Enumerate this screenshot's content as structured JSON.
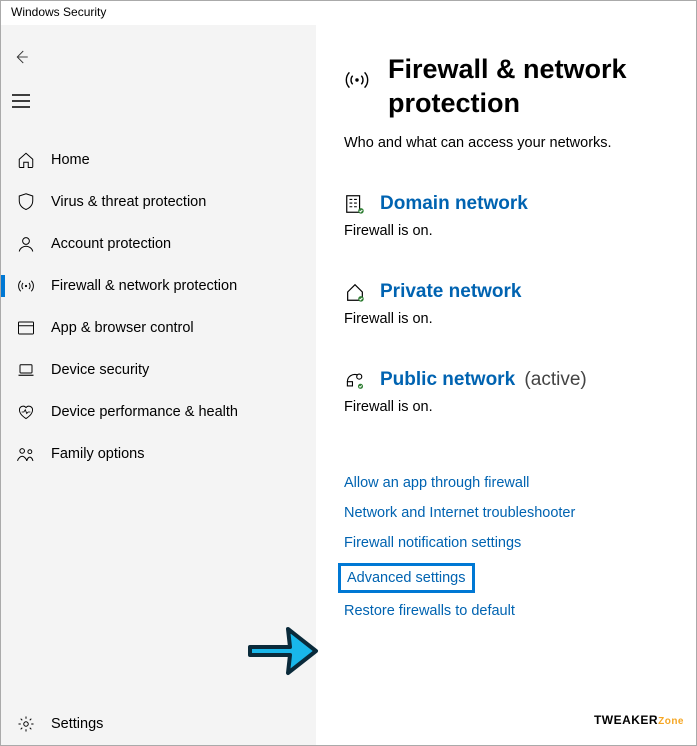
{
  "window_title": "Windows Security",
  "sidebar": {
    "items": [
      {
        "label": "Home"
      },
      {
        "label": "Virus & threat protection"
      },
      {
        "label": "Account protection"
      },
      {
        "label": "Firewall & network protection"
      },
      {
        "label": "App & browser control"
      },
      {
        "label": "Device security"
      },
      {
        "label": "Device performance & health"
      },
      {
        "label": "Family options"
      }
    ],
    "bottom": {
      "label": "Settings"
    }
  },
  "page": {
    "title": "Firewall & network protection",
    "description": "Who and what can access your networks."
  },
  "networks": [
    {
      "title": "Domain network",
      "status": "Firewall is on.",
      "suffix": ""
    },
    {
      "title": "Private network",
      "status": "Firewall is on.",
      "suffix": ""
    },
    {
      "title": "Public network",
      "status": "Firewall is on.",
      "suffix": "  (active)"
    }
  ],
  "links": [
    "Allow an app through firewall",
    "Network and Internet troubleshooter",
    "Firewall notification settings",
    "Advanced settings",
    "Restore firewalls to default"
  ],
  "brand": {
    "a": "TWEAKER",
    "b": "Zone"
  }
}
